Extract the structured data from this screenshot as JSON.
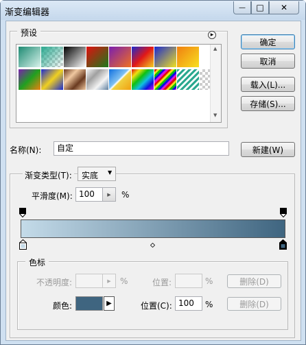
{
  "window": {
    "title": "渐变编辑器"
  },
  "titlebar": {
    "minimize_glyph": "—",
    "maximize_glyph": "□",
    "close_glyph": "✕"
  },
  "presets": {
    "label": "预设",
    "menu_glyph": "▸",
    "scroll_up_glyph": "▲",
    "scroll_down_glyph": "▼"
  },
  "buttons": {
    "ok": "确定",
    "cancel": "取消",
    "load": "载入(L)...",
    "save": "存储(S)...",
    "new": "新建(W)"
  },
  "name": {
    "label": "名称(N):",
    "value": "自定"
  },
  "gradient": {
    "type_label": "渐变类型(T):",
    "type_value": "实底",
    "smoothness_label": "平滑度(M):",
    "smoothness_value": "100",
    "percent": "%",
    "start_color": "#c4dbe9",
    "end_color": "#3f6580"
  },
  "stops": {
    "group_label": "色标",
    "opacity_label": "不透明度:",
    "opacity_value": "",
    "opacity_percent": "%",
    "opacity_location_label": "位置:",
    "opacity_location_value": "",
    "opacity_location_percent": "%",
    "opacity_delete": "删除(D)",
    "color_label": "颜色:",
    "color_value": "#3f6580",
    "color_location_label": "位置(C):",
    "color_location_value": "100",
    "color_location_percent": "%",
    "color_delete": "删除(D)"
  }
}
